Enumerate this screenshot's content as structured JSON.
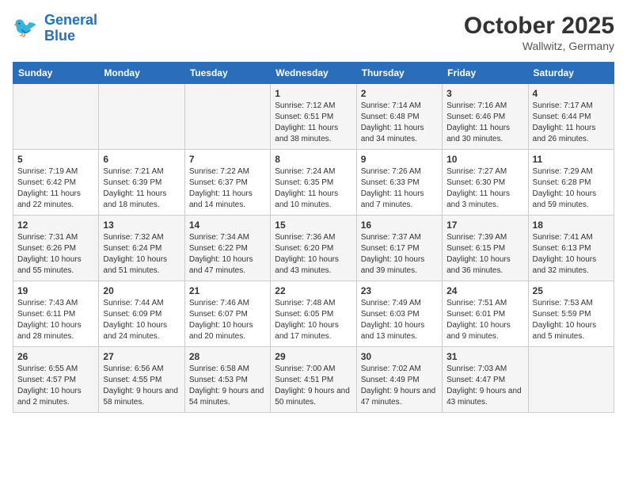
{
  "header": {
    "logo_line1": "General",
    "logo_line2": "Blue",
    "month": "October 2025",
    "location": "Wallwitz, Germany"
  },
  "days_of_week": [
    "Sunday",
    "Monday",
    "Tuesday",
    "Wednesday",
    "Thursday",
    "Friday",
    "Saturday"
  ],
  "weeks": [
    [
      {
        "day": "",
        "info": ""
      },
      {
        "day": "",
        "info": ""
      },
      {
        "day": "",
        "info": ""
      },
      {
        "day": "1",
        "info": "Sunrise: 7:12 AM\nSunset: 6:51 PM\nDaylight: 11 hours and 38 minutes."
      },
      {
        "day": "2",
        "info": "Sunrise: 7:14 AM\nSunset: 6:48 PM\nDaylight: 11 hours and 34 minutes."
      },
      {
        "day": "3",
        "info": "Sunrise: 7:16 AM\nSunset: 6:46 PM\nDaylight: 11 hours and 30 minutes."
      },
      {
        "day": "4",
        "info": "Sunrise: 7:17 AM\nSunset: 6:44 PM\nDaylight: 11 hours and 26 minutes."
      }
    ],
    [
      {
        "day": "5",
        "info": "Sunrise: 7:19 AM\nSunset: 6:42 PM\nDaylight: 11 hours and 22 minutes."
      },
      {
        "day": "6",
        "info": "Sunrise: 7:21 AM\nSunset: 6:39 PM\nDaylight: 11 hours and 18 minutes."
      },
      {
        "day": "7",
        "info": "Sunrise: 7:22 AM\nSunset: 6:37 PM\nDaylight: 11 hours and 14 minutes."
      },
      {
        "day": "8",
        "info": "Sunrise: 7:24 AM\nSunset: 6:35 PM\nDaylight: 11 hours and 10 minutes."
      },
      {
        "day": "9",
        "info": "Sunrise: 7:26 AM\nSunset: 6:33 PM\nDaylight: 11 hours and 7 minutes."
      },
      {
        "day": "10",
        "info": "Sunrise: 7:27 AM\nSunset: 6:30 PM\nDaylight: 11 hours and 3 minutes."
      },
      {
        "day": "11",
        "info": "Sunrise: 7:29 AM\nSunset: 6:28 PM\nDaylight: 10 hours and 59 minutes."
      }
    ],
    [
      {
        "day": "12",
        "info": "Sunrise: 7:31 AM\nSunset: 6:26 PM\nDaylight: 10 hours and 55 minutes."
      },
      {
        "day": "13",
        "info": "Sunrise: 7:32 AM\nSunset: 6:24 PM\nDaylight: 10 hours and 51 minutes."
      },
      {
        "day": "14",
        "info": "Sunrise: 7:34 AM\nSunset: 6:22 PM\nDaylight: 10 hours and 47 minutes."
      },
      {
        "day": "15",
        "info": "Sunrise: 7:36 AM\nSunset: 6:20 PM\nDaylight: 10 hours and 43 minutes."
      },
      {
        "day": "16",
        "info": "Sunrise: 7:37 AM\nSunset: 6:17 PM\nDaylight: 10 hours and 39 minutes."
      },
      {
        "day": "17",
        "info": "Sunrise: 7:39 AM\nSunset: 6:15 PM\nDaylight: 10 hours and 36 minutes."
      },
      {
        "day": "18",
        "info": "Sunrise: 7:41 AM\nSunset: 6:13 PM\nDaylight: 10 hours and 32 minutes."
      }
    ],
    [
      {
        "day": "19",
        "info": "Sunrise: 7:43 AM\nSunset: 6:11 PM\nDaylight: 10 hours and 28 minutes."
      },
      {
        "day": "20",
        "info": "Sunrise: 7:44 AM\nSunset: 6:09 PM\nDaylight: 10 hours and 24 minutes."
      },
      {
        "day": "21",
        "info": "Sunrise: 7:46 AM\nSunset: 6:07 PM\nDaylight: 10 hours and 20 minutes."
      },
      {
        "day": "22",
        "info": "Sunrise: 7:48 AM\nSunset: 6:05 PM\nDaylight: 10 hours and 17 minutes."
      },
      {
        "day": "23",
        "info": "Sunrise: 7:49 AM\nSunset: 6:03 PM\nDaylight: 10 hours and 13 minutes."
      },
      {
        "day": "24",
        "info": "Sunrise: 7:51 AM\nSunset: 6:01 PM\nDaylight: 10 hours and 9 minutes."
      },
      {
        "day": "25",
        "info": "Sunrise: 7:53 AM\nSunset: 5:59 PM\nDaylight: 10 hours and 5 minutes."
      }
    ],
    [
      {
        "day": "26",
        "info": "Sunrise: 6:55 AM\nSunset: 4:57 PM\nDaylight: 10 hours and 2 minutes."
      },
      {
        "day": "27",
        "info": "Sunrise: 6:56 AM\nSunset: 4:55 PM\nDaylight: 9 hours and 58 minutes."
      },
      {
        "day": "28",
        "info": "Sunrise: 6:58 AM\nSunset: 4:53 PM\nDaylight: 9 hours and 54 minutes."
      },
      {
        "day": "29",
        "info": "Sunrise: 7:00 AM\nSunset: 4:51 PM\nDaylight: 9 hours and 50 minutes."
      },
      {
        "day": "30",
        "info": "Sunrise: 7:02 AM\nSunset: 4:49 PM\nDaylight: 9 hours and 47 minutes."
      },
      {
        "day": "31",
        "info": "Sunrise: 7:03 AM\nSunset: 4:47 PM\nDaylight: 9 hours and 43 minutes."
      },
      {
        "day": "",
        "info": ""
      }
    ]
  ]
}
